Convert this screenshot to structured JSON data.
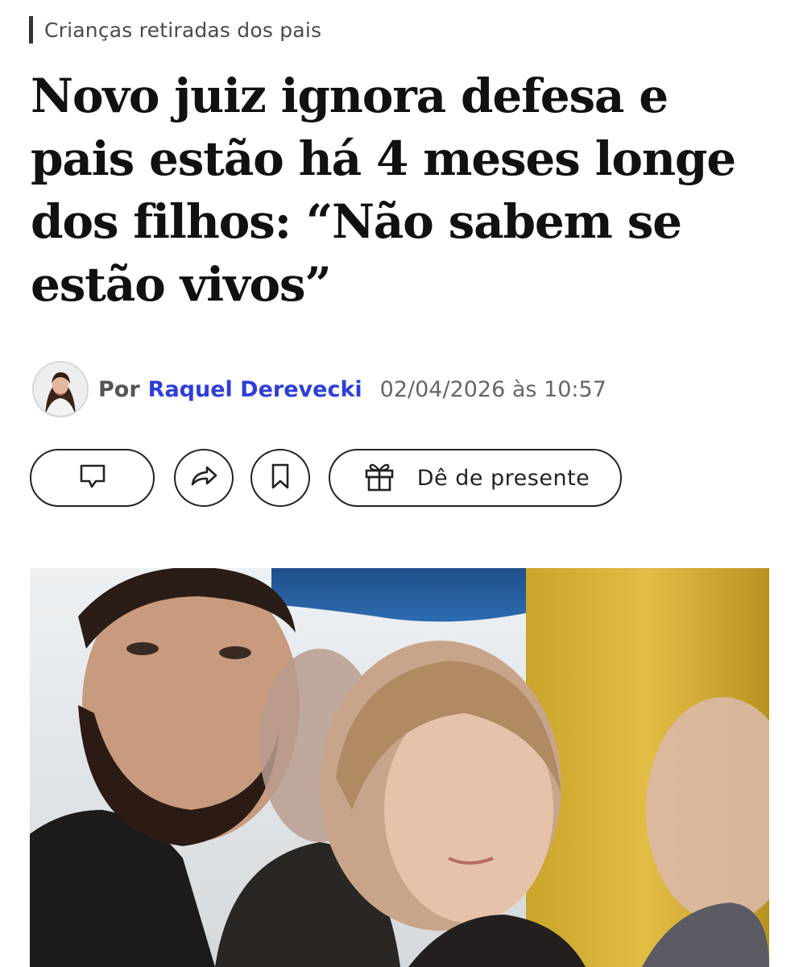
{
  "article": {
    "kicker": "Crianças retiradas dos pais",
    "headline": "Novo juiz ignora defesa e pais estão há 4 meses longe dos filhos: “Não sabem se estão vivos”",
    "byline": {
      "prefix": "Por",
      "author": "Raquel Derevecki",
      "date": "02/04/2026 às 10:57"
    }
  },
  "actions": {
    "comment_icon": "speech-bubble-icon",
    "share_icon": "share-arrow-icon",
    "save_icon": "bookmark-icon",
    "gift_icon": "gift-icon",
    "gift_label": "Dê de presente"
  },
  "colors": {
    "author_link": "#2f3ed8",
    "text": "#111111",
    "muted": "#666666"
  }
}
